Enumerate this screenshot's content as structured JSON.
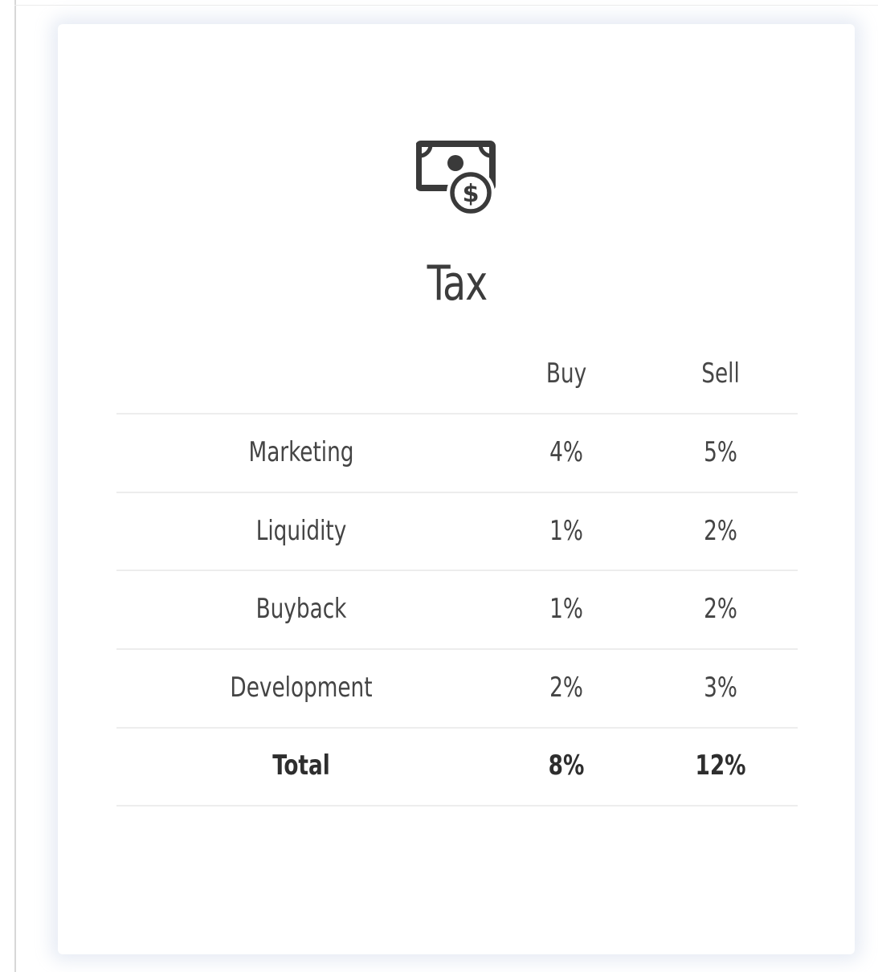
{
  "icon": "money-dollar-icon",
  "title": "Tax",
  "table": {
    "columns": [
      "Buy",
      "Sell"
    ],
    "rows": [
      {
        "label": "Marketing",
        "buy": "4%",
        "sell": "5%"
      },
      {
        "label": "Liquidity",
        "buy": "1%",
        "sell": "2%"
      },
      {
        "label": "Buyback",
        "buy": "1%",
        "sell": "2%"
      },
      {
        "label": "Development",
        "buy": "2%",
        "sell": "3%"
      }
    ],
    "total": {
      "label": "Total",
      "buy": "8%",
      "sell": "12%"
    }
  },
  "colors": {
    "text": "#444444",
    "rule": "#ededed"
  }
}
